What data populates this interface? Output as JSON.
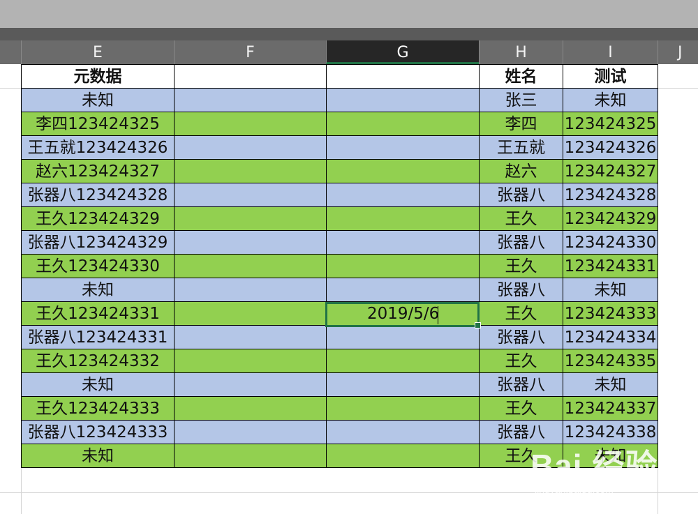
{
  "columns": [
    {
      "label": "E",
      "selected": false
    },
    {
      "label": "F",
      "selected": false
    },
    {
      "label": "G",
      "selected": true
    },
    {
      "label": "H",
      "selected": false
    },
    {
      "label": "I",
      "selected": false
    },
    {
      "label": "J",
      "selected": false
    }
  ],
  "header": {
    "e": "元数据",
    "h": "姓名",
    "i": "测试"
  },
  "rows": [
    {
      "e": "未知",
      "g": "",
      "h": "张三",
      "i": "未知"
    },
    {
      "e": "李四123424325",
      "g": "",
      "h": "李四",
      "i": "123424325"
    },
    {
      "e": "王五就123424326",
      "g": "",
      "h": "王五就",
      "i": "123424326"
    },
    {
      "e": "赵六123424327",
      "g": "",
      "h": "赵六",
      "i": "123424327"
    },
    {
      "e": "张器八123424328",
      "g": "",
      "h": "张器八",
      "i": "123424328"
    },
    {
      "e": "王久123424329",
      "g": "",
      "h": "王久",
      "i": "123424329"
    },
    {
      "e": "张器八123424329",
      "g": "",
      "h": "张器八",
      "i": "123424330"
    },
    {
      "e": "王久123424330",
      "g": "",
      "h": "王久",
      "i": "123424331"
    },
    {
      "e": "未知",
      "g": "",
      "h": "张器八",
      "i": "未知"
    },
    {
      "e": "王久123424331",
      "g": "2019/5/6",
      "h": "王久",
      "i": "123424333"
    },
    {
      "e": "张器八123424331",
      "g": "",
      "h": "张器八",
      "i": "123424334"
    },
    {
      "e": "王久123424332",
      "g": "",
      "h": "王久",
      "i": "123424335"
    },
    {
      "e": "未知",
      "g": "",
      "h": "张器八",
      "i": "未知"
    },
    {
      "e": "王久123424333",
      "g": "",
      "h": "王久",
      "i": "123424337"
    },
    {
      "e": "张器八123424333",
      "g": "",
      "h": "张器八",
      "i": "123424338"
    },
    {
      "e": "未知",
      "g": "",
      "h": "王久",
      "i": "未知"
    }
  ],
  "watermark": {
    "logo": "Bai 经验",
    "url": "jingyan.baidu.com"
  },
  "colors": {
    "blue_fill": "#b4c6e7",
    "green_fill": "#92d050",
    "selection": "#217346"
  }
}
